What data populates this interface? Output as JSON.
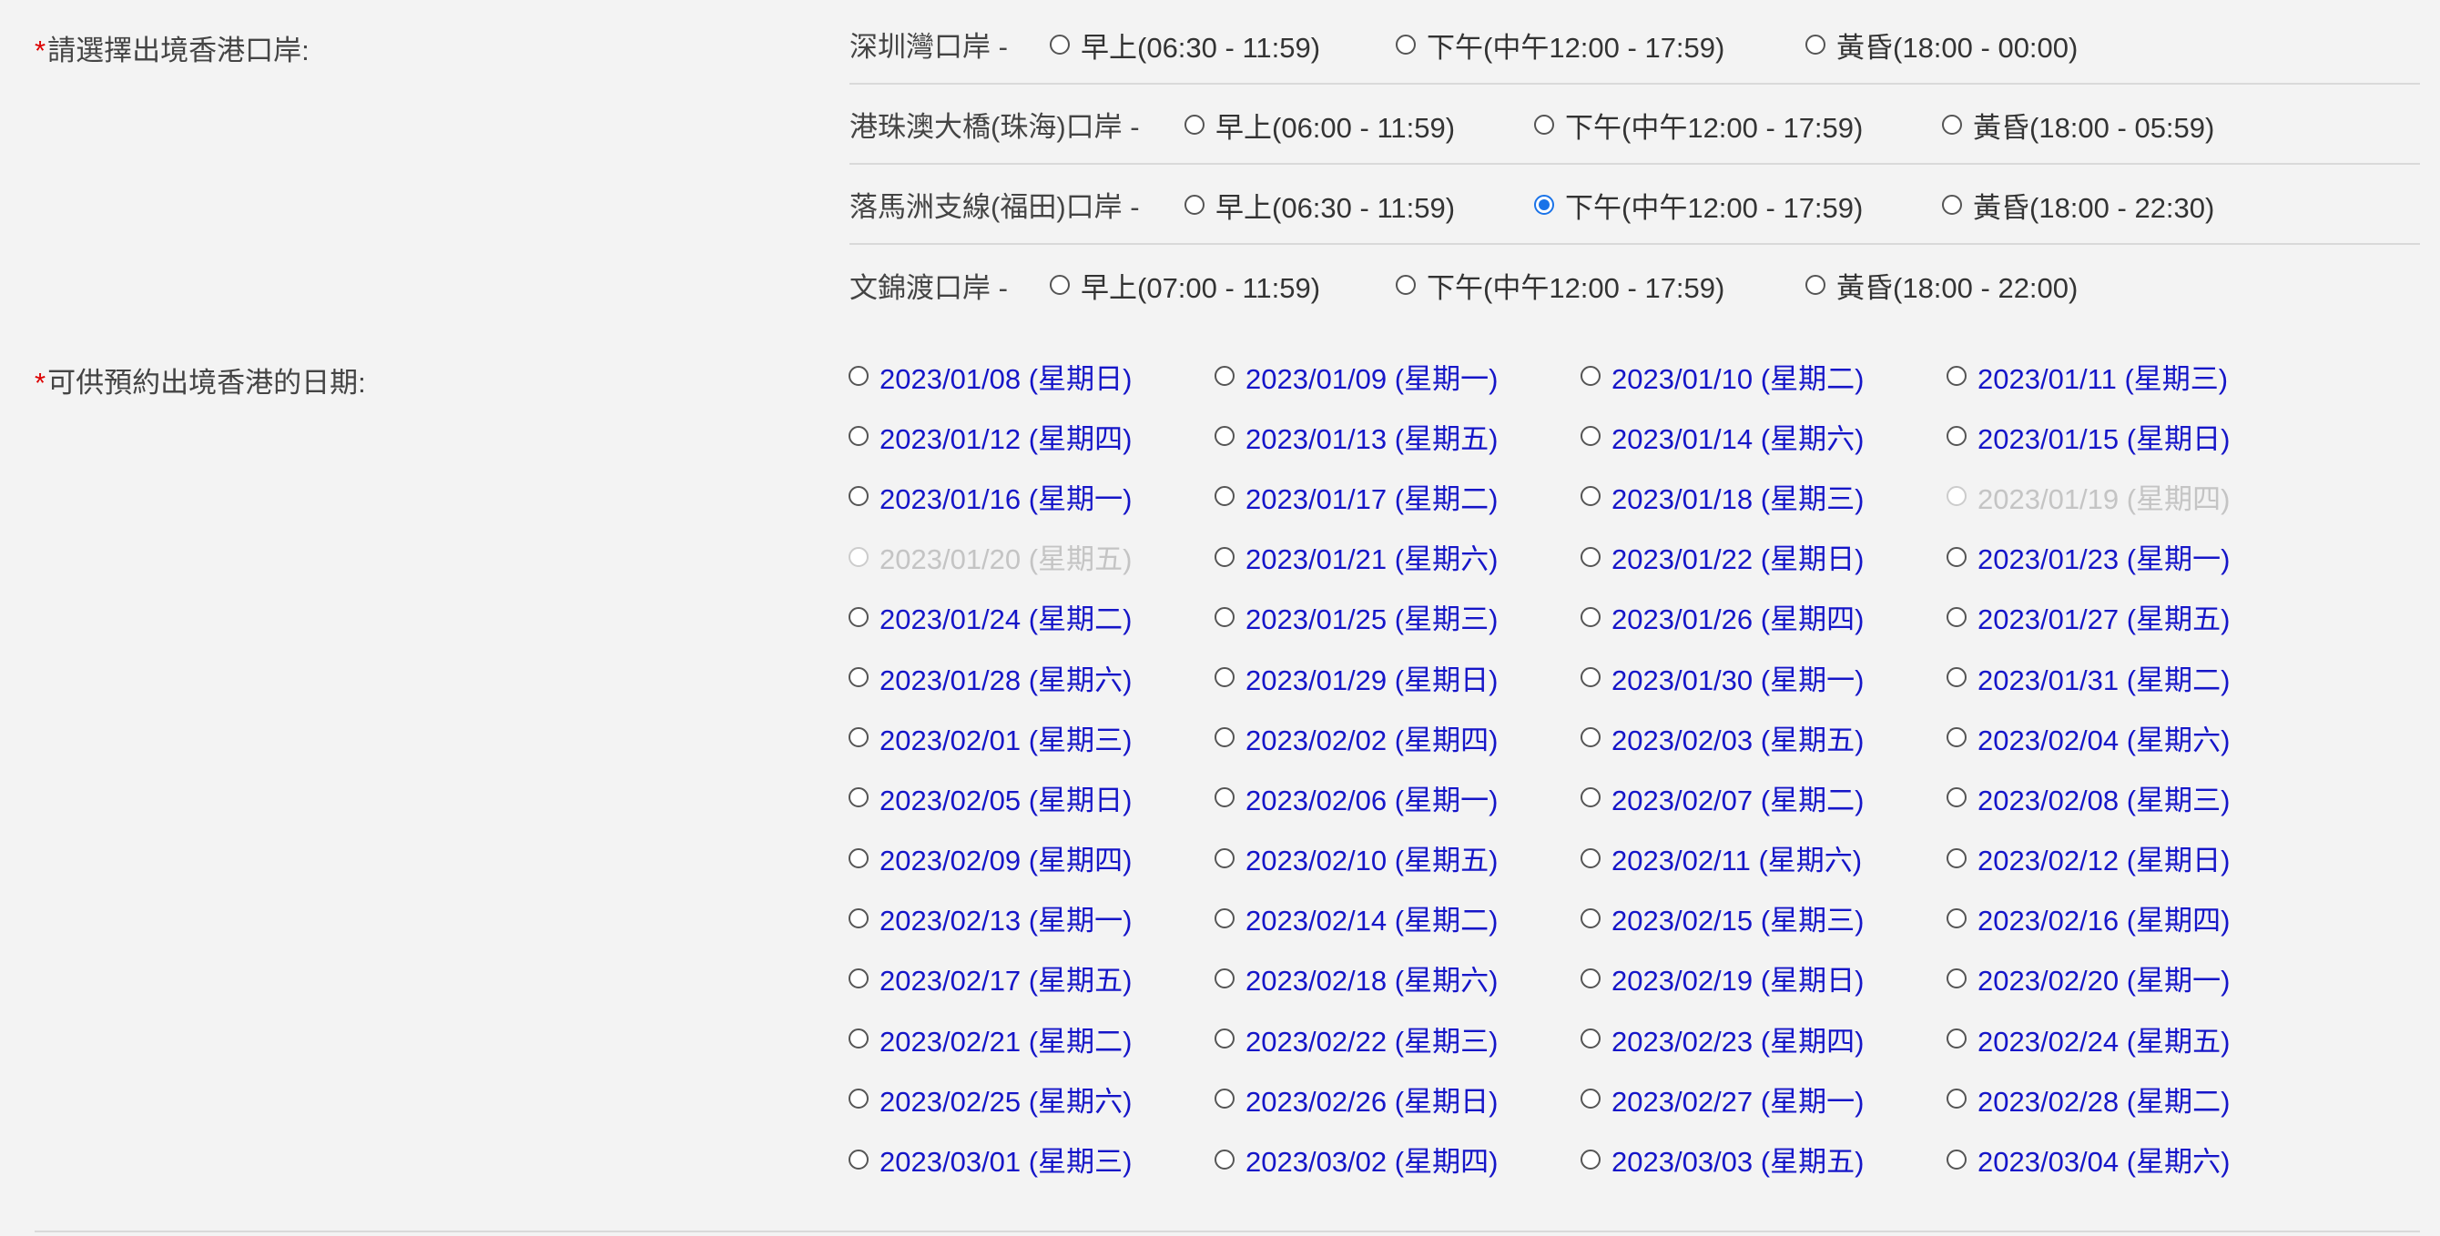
{
  "ports_label": {
    "asterisk": "*",
    "text": "請選擇出境香港口岸:"
  },
  "ports": [
    {
      "name": "深圳灣口岸 -",
      "options": [
        {
          "label": "早上(06:30 - 11:59)",
          "checked": false
        },
        {
          "label": "下午(中午12:00 - 17:59)",
          "checked": false
        },
        {
          "label": "黃昏(18:00 - 00:00)",
          "checked": false
        }
      ]
    },
    {
      "name": "港珠澳大橋(珠海)口岸 -",
      "options": [
        {
          "label": "早上(06:00 - 11:59)",
          "checked": false
        },
        {
          "label": "下午(中午12:00 - 17:59)",
          "checked": false
        },
        {
          "label": "黃昏(18:00 - 05:59)",
          "checked": false
        }
      ]
    },
    {
      "name": "落馬洲支線(福田)口岸 -",
      "options": [
        {
          "label": "早上(06:30 - 11:59)",
          "checked": false
        },
        {
          "label": "下午(中午12:00 - 17:59)",
          "checked": true
        },
        {
          "label": "黃昏(18:00 - 22:30)",
          "checked": false
        }
      ]
    },
    {
      "name": "文錦渡口岸 -",
      "options": [
        {
          "label": "早上(07:00 - 11:59)",
          "checked": false
        },
        {
          "label": "下午(中午12:00 - 17:59)",
          "checked": false
        },
        {
          "label": "黃昏(18:00 - 22:00)",
          "checked": false
        }
      ]
    }
  ],
  "dates_label": {
    "asterisk": "*",
    "text": "可供預約出境香港的日期:"
  },
  "dates": [
    {
      "label": "2023/01/08 (星期日)",
      "disabled": false
    },
    {
      "label": "2023/01/09 (星期一)",
      "disabled": false
    },
    {
      "label": "2023/01/10 (星期二)",
      "disabled": false
    },
    {
      "label": "2023/01/11 (星期三)",
      "disabled": false
    },
    {
      "label": "2023/01/12 (星期四)",
      "disabled": false
    },
    {
      "label": "2023/01/13 (星期五)",
      "disabled": false
    },
    {
      "label": "2023/01/14 (星期六)",
      "disabled": false
    },
    {
      "label": "2023/01/15 (星期日)",
      "disabled": false
    },
    {
      "label": "2023/01/16 (星期一)",
      "disabled": false
    },
    {
      "label": "2023/01/17 (星期二)",
      "disabled": false
    },
    {
      "label": "2023/01/18 (星期三)",
      "disabled": false
    },
    {
      "label": "2023/01/19 (星期四)",
      "disabled": true
    },
    {
      "label": "2023/01/20 (星期五)",
      "disabled": true
    },
    {
      "label": "2023/01/21 (星期六)",
      "disabled": false
    },
    {
      "label": "2023/01/22 (星期日)",
      "disabled": false
    },
    {
      "label": "2023/01/23 (星期一)",
      "disabled": false
    },
    {
      "label": "2023/01/24 (星期二)",
      "disabled": false
    },
    {
      "label": "2023/01/25 (星期三)",
      "disabled": false
    },
    {
      "label": "2023/01/26 (星期四)",
      "disabled": false
    },
    {
      "label": "2023/01/27 (星期五)",
      "disabled": false
    },
    {
      "label": "2023/01/28 (星期六)",
      "disabled": false
    },
    {
      "label": "2023/01/29 (星期日)",
      "disabled": false
    },
    {
      "label": "2023/01/30 (星期一)",
      "disabled": false
    },
    {
      "label": "2023/01/31 (星期二)",
      "disabled": false
    },
    {
      "label": "2023/02/01 (星期三)",
      "disabled": false
    },
    {
      "label": "2023/02/02 (星期四)",
      "disabled": false
    },
    {
      "label": "2023/02/03 (星期五)",
      "disabled": false
    },
    {
      "label": "2023/02/04 (星期六)",
      "disabled": false
    },
    {
      "label": "2023/02/05 (星期日)",
      "disabled": false
    },
    {
      "label": "2023/02/06 (星期一)",
      "disabled": false
    },
    {
      "label": "2023/02/07 (星期二)",
      "disabled": false
    },
    {
      "label": "2023/02/08 (星期三)",
      "disabled": false
    },
    {
      "label": "2023/02/09 (星期四)",
      "disabled": false
    },
    {
      "label": "2023/02/10 (星期五)",
      "disabled": false
    },
    {
      "label": "2023/02/11 (星期六)",
      "disabled": false
    },
    {
      "label": "2023/02/12 (星期日)",
      "disabled": false
    },
    {
      "label": "2023/02/13 (星期一)",
      "disabled": false
    },
    {
      "label": "2023/02/14 (星期二)",
      "disabled": false
    },
    {
      "label": "2023/02/15 (星期三)",
      "disabled": false
    },
    {
      "label": "2023/02/16 (星期四)",
      "disabled": false
    },
    {
      "label": "2023/02/17 (星期五)",
      "disabled": false
    },
    {
      "label": "2023/02/18 (星期六)",
      "disabled": false
    },
    {
      "label": "2023/02/19 (星期日)",
      "disabled": false
    },
    {
      "label": "2023/02/20 (星期一)",
      "disabled": false
    },
    {
      "label": "2023/02/21 (星期二)",
      "disabled": false
    },
    {
      "label": "2023/02/22 (星期三)",
      "disabled": false
    },
    {
      "label": "2023/02/23 (星期四)",
      "disabled": false
    },
    {
      "label": "2023/02/24 (星期五)",
      "disabled": false
    },
    {
      "label": "2023/02/25 (星期六)",
      "disabled": false
    },
    {
      "label": "2023/02/26 (星期日)",
      "disabled": false
    },
    {
      "label": "2023/02/27 (星期一)",
      "disabled": false
    },
    {
      "label": "2023/02/28 (星期二)",
      "disabled": false
    },
    {
      "label": "2023/03/01 (星期三)",
      "disabled": false
    },
    {
      "label": "2023/03/02 (星期四)",
      "disabled": false
    },
    {
      "label": "2023/03/03 (星期五)",
      "disabled": false
    },
    {
      "label": "2023/03/04 (星期六)",
      "disabled": false
    }
  ]
}
